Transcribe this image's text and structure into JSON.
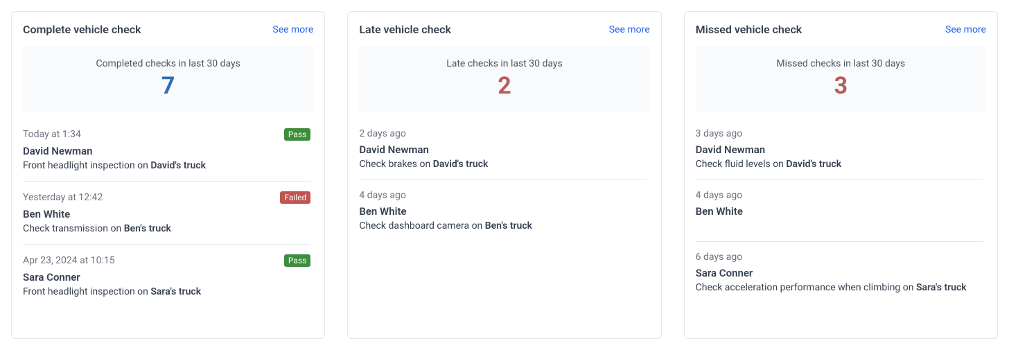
{
  "cards": [
    {
      "title": "Complete vehicle check",
      "see_more": "See more",
      "stat_label": "Completed checks in last 30 days",
      "stat_value": "7",
      "stat_color": "blue",
      "items": [
        {
          "time": "Today at 1:34",
          "badge": "Pass",
          "badge_type": "pass",
          "name": "David Newman",
          "desc_prefix": "Front headlight inspection on ",
          "vehicle": "David's truck"
        },
        {
          "time": "Yesterday at 12:42",
          "badge": "Failed",
          "badge_type": "failed",
          "name": "Ben White",
          "desc_prefix": "Check transmission on ",
          "vehicle": "Ben's truck"
        },
        {
          "time": "Apr 23, 2024 at 10:15",
          "badge": "Pass",
          "badge_type": "pass",
          "name": "Sara Conner",
          "desc_prefix": "Front headlight inspection on ",
          "vehicle": "Sara's truck"
        }
      ]
    },
    {
      "title": "Late vehicle check",
      "see_more": "See more",
      "stat_label": "Late checks in last 30 days",
      "stat_value": "2",
      "stat_color": "red",
      "items": [
        {
          "time": "2 days ago",
          "badge": "",
          "badge_type": "",
          "name": "David Newman",
          "desc_prefix": "Check brakes on ",
          "vehicle": "David's truck"
        },
        {
          "time": "4 days ago",
          "badge": "",
          "badge_type": "",
          "name": "Ben White",
          "desc_prefix": "Check dashboard camera on ",
          "vehicle": "Ben's truck"
        }
      ]
    },
    {
      "title": "Missed vehicle check",
      "see_more": "See more",
      "stat_label": "Missed checks in last 30 days",
      "stat_value": "3",
      "stat_color": "red",
      "items": [
        {
          "time": "3 days ago",
          "badge": "",
          "badge_type": "",
          "name": "David Newman",
          "desc_prefix": "Check fluid levels on ",
          "vehicle": "David's truck"
        },
        {
          "time": "4 days ago",
          "badge": "",
          "badge_type": "",
          "name": "Ben White",
          "desc_prefix": "",
          "vehicle": ""
        },
        {
          "time": "6 days ago",
          "badge": "",
          "badge_type": "",
          "name": "Sara Conner",
          "desc_prefix": "Check acceleration performance when climbing on ",
          "vehicle": "Sara's truck"
        }
      ]
    }
  ]
}
